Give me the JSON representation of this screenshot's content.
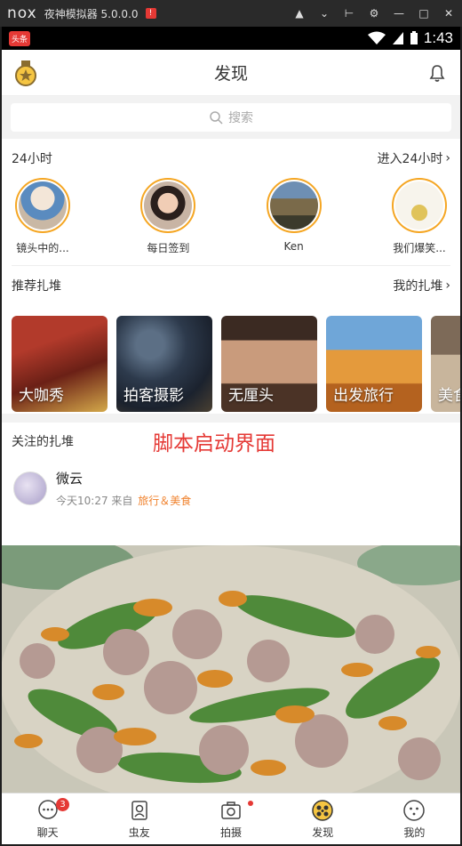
{
  "emulator": {
    "logo": "nox",
    "title": "夜神模拟器 5.0.0.0",
    "alert": "!"
  },
  "status_bar": {
    "app_notification": "头条",
    "time": "1:43"
  },
  "header": {
    "title": "发现"
  },
  "search": {
    "placeholder": "搜索"
  },
  "hours24": {
    "title": "24小时",
    "enter_link": "进入24小时",
    "avatars": [
      {
        "label": "镜头中的..."
      },
      {
        "label": "每日签到"
      },
      {
        "label": "Ken"
      },
      {
        "label": "我们爆笑..."
      }
    ]
  },
  "recommend": {
    "title": "推荐扎堆",
    "my_link": "我的扎堆",
    "cards": [
      {
        "label": "大咖秀"
      },
      {
        "label": "拍客摄影"
      },
      {
        "label": "无厘头"
      },
      {
        "label": "出发旅行"
      },
      {
        "label": "美食"
      }
    ]
  },
  "following": {
    "title": "关注的扎堆",
    "script_note": "脚本启动界面",
    "post": {
      "name": "微云",
      "time": "今天10:27",
      "from_label": "来自",
      "tag": "旅行＆美食"
    }
  },
  "tabbar": {
    "tabs": [
      {
        "label": "聊天",
        "badge": "3"
      },
      {
        "label": "虫友"
      },
      {
        "label": "拍摄"
      },
      {
        "label": "发现"
      },
      {
        "label": "我的"
      }
    ]
  },
  "colors": {
    "accent": "#f5a623",
    "badge": "#e53935",
    "tag": "#f0822d"
  }
}
